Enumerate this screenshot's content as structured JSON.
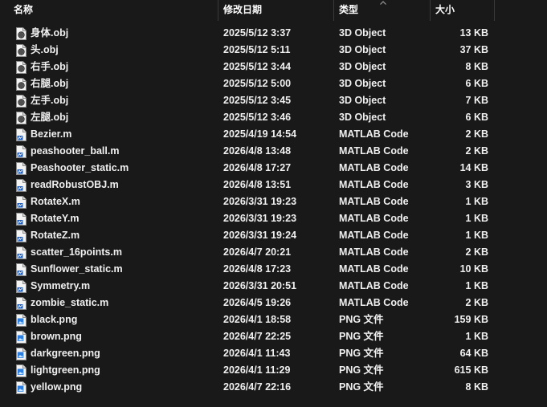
{
  "header": {
    "name": "名称",
    "date": "修改日期",
    "type": "类型",
    "size": "大小"
  },
  "files": [
    {
      "name": "身体.obj",
      "date": "2025/5/12 3:37",
      "type": "3D Object",
      "size": "13 KB",
      "icon": "3d-object-icon"
    },
    {
      "name": "头.obj",
      "date": "2025/5/12 5:11",
      "type": "3D Object",
      "size": "37 KB",
      "icon": "3d-object-icon"
    },
    {
      "name": "右手.obj",
      "date": "2025/5/12 3:44",
      "type": "3D Object",
      "size": "8 KB",
      "icon": "3d-object-icon"
    },
    {
      "name": "右腿.obj",
      "date": "2025/5/12 5:00",
      "type": "3D Object",
      "size": "6 KB",
      "icon": "3d-object-icon"
    },
    {
      "name": "左手.obj",
      "date": "2025/5/12 3:45",
      "type": "3D Object",
      "size": "7 KB",
      "icon": "3d-object-icon"
    },
    {
      "name": "左腿.obj",
      "date": "2025/5/12 3:46",
      "type": "3D Object",
      "size": "6 KB",
      "icon": "3d-object-icon"
    },
    {
      "name": "Bezier.m",
      "date": "2025/4/19 14:54",
      "type": "MATLAB Code",
      "size": "2 KB",
      "icon": "matlab-file-icon"
    },
    {
      "name": "peashooter_ball.m",
      "date": "2026/4/8 13:48",
      "type": "MATLAB Code",
      "size": "2 KB",
      "icon": "matlab-file-icon"
    },
    {
      "name": "Peashooter_static.m",
      "date": "2026/4/8 17:27",
      "type": "MATLAB Code",
      "size": "14 KB",
      "icon": "matlab-file-icon"
    },
    {
      "name": "readRobustOBJ.m",
      "date": "2026/4/8 13:51",
      "type": "MATLAB Code",
      "size": "3 KB",
      "icon": "matlab-file-icon"
    },
    {
      "name": "RotateX.m",
      "date": "2026/3/31 19:23",
      "type": "MATLAB Code",
      "size": "1 KB",
      "icon": "matlab-file-icon"
    },
    {
      "name": "RotateY.m",
      "date": "2026/3/31 19:23",
      "type": "MATLAB Code",
      "size": "1 KB",
      "icon": "matlab-file-icon"
    },
    {
      "name": "RotateZ.m",
      "date": "2026/3/31 19:24",
      "type": "MATLAB Code",
      "size": "1 KB",
      "icon": "matlab-file-icon"
    },
    {
      "name": "scatter_16points.m",
      "date": "2026/4/7 20:21",
      "type": "MATLAB Code",
      "size": "2 KB",
      "icon": "matlab-file-icon"
    },
    {
      "name": "Sunflower_static.m",
      "date": "2026/4/8 17:23",
      "type": "MATLAB Code",
      "size": "10 KB",
      "icon": "matlab-file-icon"
    },
    {
      "name": "Symmetry.m",
      "date": "2026/3/31 20:51",
      "type": "MATLAB Code",
      "size": "1 KB",
      "icon": "matlab-file-icon"
    },
    {
      "name": "zombie_static.m",
      "date": "2026/4/5 19:26",
      "type": "MATLAB Code",
      "size": "2 KB",
      "icon": "matlab-file-icon"
    },
    {
      "name": "black.png",
      "date": "2026/4/1 18:58",
      "type": "PNG 文件",
      "size": "159 KB",
      "icon": "png-file-icon"
    },
    {
      "name": "brown.png",
      "date": "2026/4/7 22:25",
      "type": "PNG 文件",
      "size": "1 KB",
      "icon": "png-file-icon"
    },
    {
      "name": "darkgreen.png",
      "date": "2026/4/1 11:43",
      "type": "PNG 文件",
      "size": "64 KB",
      "icon": "png-file-icon"
    },
    {
      "name": "lightgreen.png",
      "date": "2026/4/1 11:29",
      "type": "PNG 文件",
      "size": "615 KB",
      "icon": "png-file-icon"
    },
    {
      "name": "yellow.png",
      "date": "2026/4/7 22:16",
      "type": "PNG 文件",
      "size": "8 KB",
      "icon": "png-file-icon"
    }
  ],
  "colors": {
    "background": "#191919",
    "text": "#f0f0f0",
    "separator": "#3a3a3a",
    "matlab_accent": "#1f5fbf",
    "png_accent": "#2b7de0"
  }
}
